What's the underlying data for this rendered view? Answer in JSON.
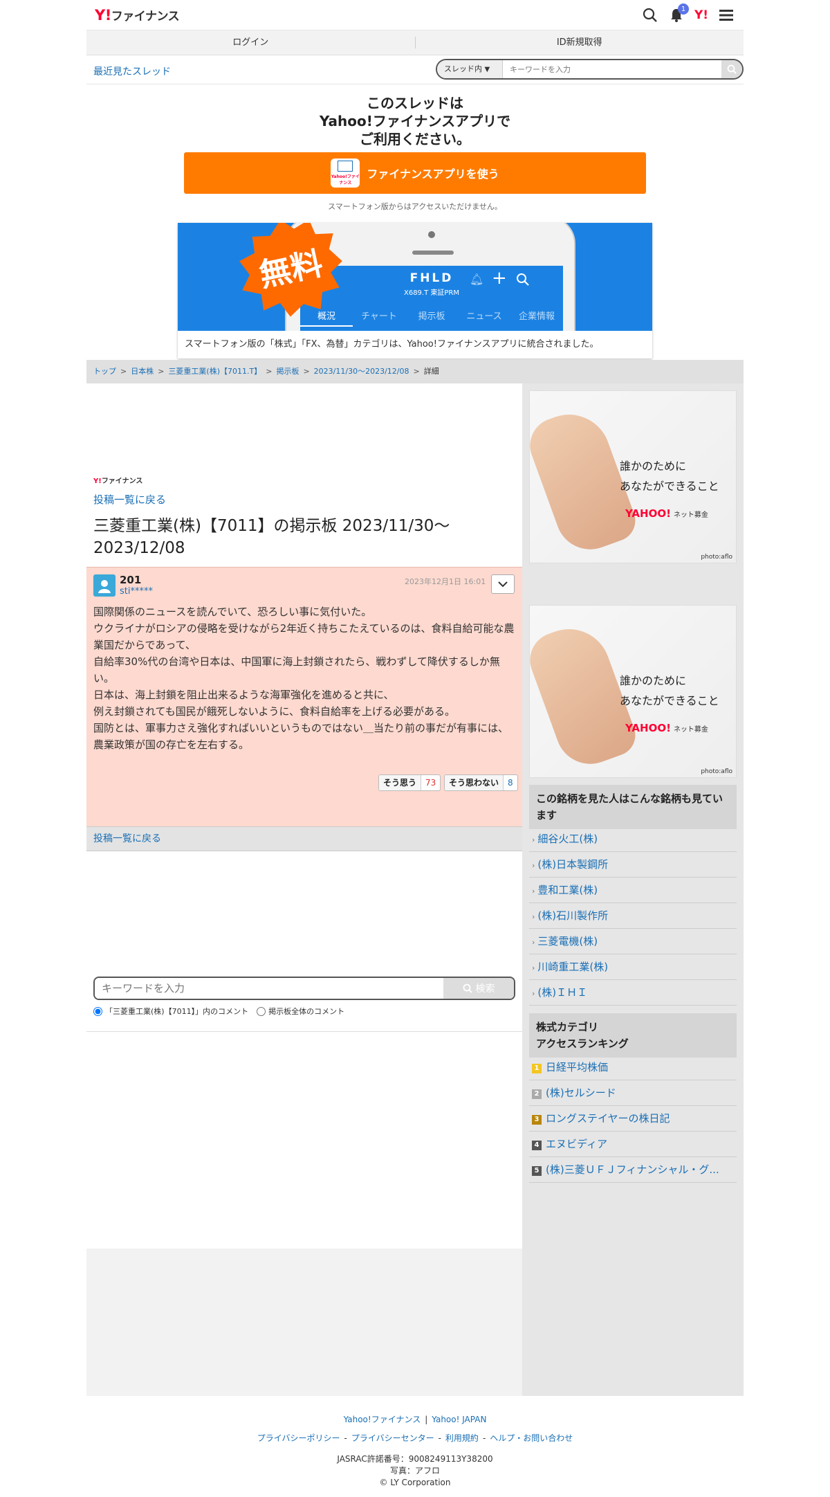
{
  "header": {
    "logo_mark": "Y!",
    "logo_text": "ファイナンス",
    "bell_badge": "1",
    "yj_label": "Y!"
  },
  "loginbar": {
    "login": "ログイン",
    "register": "ID新規取得"
  },
  "searchrow": {
    "recent": "最近見たスレッド",
    "scope": "スレッド内",
    "placeholder": "キーワードを入力"
  },
  "promo": {
    "title_line1": "このスレッドは",
    "title_line2": "Yahoo!ファイナンスアプリで",
    "title_line3": "ご利用ください。",
    "button": "ファイナンスアプリを使う",
    "icon_label": "Yahoo!ファイナンス",
    "note": "スマートフォン版からはアクセスいただけません。",
    "banner": {
      "free": "無料",
      "ticker": "FHLD",
      "ticker_sub": "X689.T 東証PRM",
      "tabs": [
        "概況",
        "チャート",
        "掲示板",
        "ニュース",
        "企業情報"
      ],
      "caption": "スマートフォン版の「株式」「FX、為替」カテゴリは、Yahoo!ファイナンスアプリに統合されました。"
    }
  },
  "breadcrumb": {
    "items": [
      "トップ",
      "日本株",
      "三菱重工業(株)【7011.T】",
      "掲示板",
      "2023/11/30〜2023/12/08"
    ],
    "current": "詳細"
  },
  "main": {
    "sub_logo_mark": "Y!",
    "sub_logo_text": "ファイナンス",
    "back_link": "投稿一覧に戻る",
    "title": "三菱重工業(株)【7011】の掲示板 2023/11/30〜2023/12/08",
    "post": {
      "number": "201",
      "user": "sti*****",
      "date": "2023年12月1日 16:01",
      "body": [
        "国際関係のニュースを読んでいて、恐ろしい事に気付いた。",
        "ウクライナがロシアの侵略を受けながら2年近く持ちこたえているのは、食料自給可能な農業国だからであって、",
        "自給率30%代の台湾や日本は、中国軍に海上封鎖されたら、戦わずして降伏するしか無い。",
        "日本は、海上封鎖を阻止出来るような海軍強化を進めると共に、",
        "例え封鎖されても国民が餓死しないように、食料自給率を上げる必要がある。",
        "国防とは、軍事力さえ強化すればいいというものではない＿当たり前の事だが有事には、農業政策が国の存亡を左右する。"
      ],
      "agree_label": "そう思う",
      "agree_count": "73",
      "disagree_label": "そう思わない",
      "disagree_count": "8"
    },
    "back_bar": "投稿一覧に戻る",
    "search": {
      "placeholder": "キーワードを入力",
      "button": "検索",
      "option1": "「三菱重工業(株)【7011】」内のコメント",
      "option2": "掲示板全体のコメント"
    }
  },
  "side": {
    "ad": {
      "line1": "誰かのために",
      "line2": "あなたができること",
      "brand": "YAHOO!",
      "brand_sub": "ネット募金",
      "credit": "photo:aflo"
    },
    "related_title": "この銘柄を見た人はこんな銘柄も見ています",
    "related": [
      "細谷火工(株)",
      "(株)日本製鋼所",
      "豊和工業(株)",
      "(株)石川製作所",
      "三菱電機(株)",
      "川崎重工業(株)",
      "(株)ＩＨＩ"
    ],
    "ranking_title_line1": "株式カテゴリ",
    "ranking_title_line2": "アクセスランキング",
    "ranking": [
      {
        "rank": "1",
        "name": "日経平均株価",
        "color": "#f3c622"
      },
      {
        "rank": "2",
        "name": "(株)セルシード",
        "color": "#aaaaaa"
      },
      {
        "rank": "3",
        "name": "ロングステイヤーの株日記",
        "color": "#b8860b"
      },
      {
        "rank": "4",
        "name": "エヌビディア",
        "color": "#555555"
      },
      {
        "rank": "5",
        "name": "(株)三菱ＵＦＪフィナンシャル・グ...",
        "color": "#555555"
      }
    ]
  },
  "footer": {
    "link1": "Yahoo!ファイナンス",
    "link2": "Yahoo! JAPAN",
    "links": [
      "プライバシーポリシー",
      "プライバシーセンター",
      "利用規約",
      "ヘルプ・お問い合わせ"
    ],
    "jasrac": "JASRAC許諾番号：9008249113Y38200",
    "photo": "写真：アフロ",
    "copyright": "© LY Corporation"
  }
}
